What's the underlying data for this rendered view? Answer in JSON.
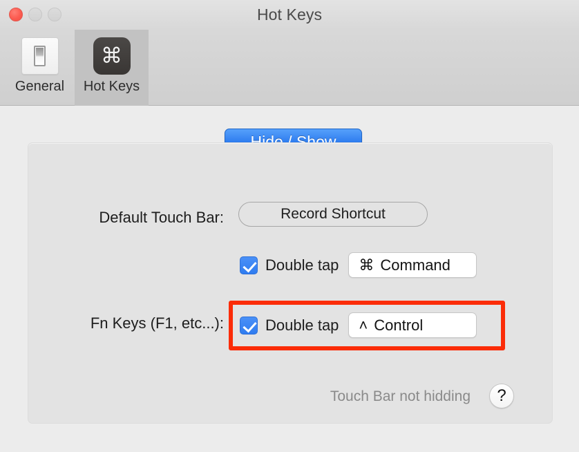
{
  "window": {
    "title": "Hot Keys",
    "controls": {
      "close": "close-button",
      "minimize": "minimize-button",
      "zoom": "zoom-button"
    }
  },
  "toolbar": {
    "tabs": [
      {
        "label": "General",
        "icon": "light-switch-icon",
        "selected": false
      },
      {
        "label": "Hot Keys",
        "icon": "command-key-icon",
        "glyph": "⌘",
        "selected": true
      }
    ]
  },
  "content": {
    "section_tab": {
      "label": "Hide / Show",
      "accent_color": "#2f7def",
      "selected": true
    },
    "rows": [
      {
        "label": "Default Touch Bar:",
        "button": "Record Shortcut",
        "checkbox": {
          "checked": true,
          "label": "Double tap",
          "value": "Command",
          "glyph": "⌘"
        }
      },
      {
        "label": "Fn Keys (F1, etc...):",
        "checkbox": {
          "checked": true,
          "label": "Double tap",
          "value": "Control",
          "glyph": "˄"
        }
      }
    ],
    "status": "Touch Bar not hidding",
    "help_label": "?"
  },
  "annotation": {
    "color": "#fb2c08",
    "target": "fn-keys-double-tap-row"
  }
}
